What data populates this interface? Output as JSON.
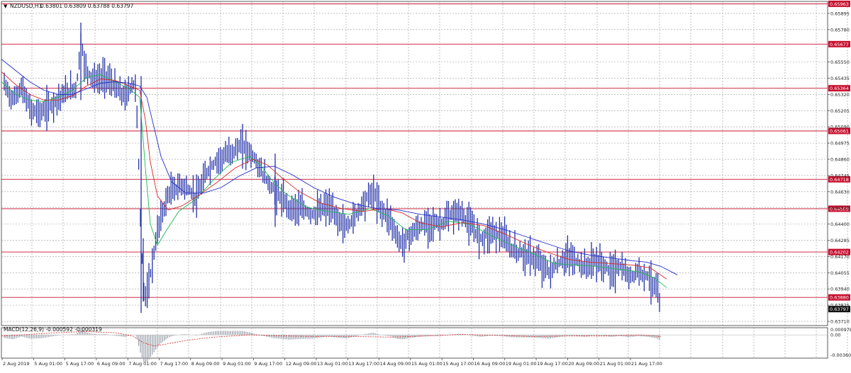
{
  "header": {
    "arrow": "▼",
    "symbol": "NZDUSD,H1",
    "ohlc": "0.63801 0.63809 0.63788 0.63797"
  },
  "macd_header": "MACD(12,26,9) -0.000592 -0.000319",
  "colors": {
    "background": "#ffffff",
    "candles": "#2433a8",
    "level_line": "#c8102e",
    "level_tag": "#c8102e",
    "ma_fast": "#1db954",
    "ma_mid": "#d62828",
    "ma_slow": "#1f2bcc",
    "macd_hist": "#9aa0aa",
    "macd_signal": "#d62828",
    "grid": "#9a9a9a"
  },
  "chart_data": {
    "type": "line",
    "title": "NZDUSD,H1",
    "price_axis_ticks": [
      "0.65895",
      "0.65780",
      "0.65550",
      "0.65435",
      "0.65320",
      "0.65205",
      "0.65090",
      "0.64975",
      "0.64860",
      "0.64745",
      "0.64630",
      "0.64515",
      "0.64400",
      "0.64285",
      "0.64170",
      "0.64055",
      "0.63940",
      "0.63825",
      "0.63710"
    ],
    "price_ylim": [
      0.6368,
      0.6598
    ],
    "horizontal_levels": [
      "0.65963",
      "0.65677",
      "0.65364",
      "0.65061",
      "0.64718",
      "0.64509",
      "0.64202",
      "0.63880"
    ],
    "current_price": "0.63797",
    "macd_axis_ticks": [
      "0.000978",
      "0.00",
      "-0.003601"
    ],
    "macd_ylim": [
      -0.0042,
      0.0013
    ],
    "x_labels": [
      "2 Aug 2019",
      "5 Aug 01:00",
      "5 Aug 17:00",
      "6 Aug 09:00",
      "7 Aug 01:00",
      "7 Aug 17:00",
      "8 Aug 09:00",
      "9 Aug 01:00",
      "9 Aug 17:00",
      "12 Aug 09:00",
      "13 Aug 01:00",
      "13 Aug 17:00",
      "14 Aug 09:00",
      "15 Aug 01:00",
      "15 Aug 17:00",
      "16 Aug 09:00",
      "19 Aug 01:00",
      "19 Aug 17:00",
      "20 Aug 09:00",
      "21 Aug 01:00",
      "21 Aug 17:00"
    ],
    "series": [
      {
        "kind": "price",
        "x": [
          0,
          16,
          28,
          41,
          57,
          73,
          90,
          106,
          112,
          118,
          126,
          135,
          147,
          160,
          174,
          185,
          190,
          196,
          200,
          205,
          212,
          222,
          236,
          255,
          275,
          290,
          305,
          318,
          330,
          340,
          348,
          356,
          366,
          378,
          390,
          405,
          420,
          440,
          460,
          475,
          487,
          500,
          512,
          524,
          536,
          548,
          558,
          565,
          575,
          590,
          606,
          620,
          634,
          645,
          660,
          676,
          690,
          705,
          720,
          730,
          745,
          760,
          772,
          788,
          800,
          812,
          824,
          836,
          848,
          860,
          872,
          885,
          898,
          912,
          924,
          930
        ],
        "y": [
          0.6543,
          0.6528,
          0.6537,
          0.6521,
          0.6519,
          0.6526,
          0.6533,
          0.6537,
          0.6571,
          0.6551,
          0.6545,
          0.6542,
          0.6545,
          0.6537,
          0.653,
          0.654,
          0.6536,
          0.6445,
          0.6395,
          0.6388,
          0.641,
          0.644,
          0.6462,
          0.6468,
          0.6459,
          0.6477,
          0.6486,
          0.6489,
          0.6493,
          0.6496,
          0.6492,
          0.6487,
          0.6478,
          0.6468,
          0.6461,
          0.6452,
          0.6451,
          0.6447,
          0.6453,
          0.6443,
          0.6438,
          0.6447,
          0.6457,
          0.6463,
          0.645,
          0.6444,
          0.643,
          0.6426,
          0.6432,
          0.6438,
          0.6441,
          0.644,
          0.6446,
          0.6449,
          0.644,
          0.643,
          0.6435,
          0.6432,
          0.6422,
          0.642,
          0.6417,
          0.6412,
          0.6406,
          0.6413,
          0.6417,
          0.6413,
          0.6409,
          0.6414,
          0.6411,
          0.6406,
          0.641,
          0.6402,
          0.6407,
          0.6403,
          0.6393,
          0.638
        ]
      },
      {
        "kind": "ma_fast",
        "x": [
          0,
          20,
          40,
          60,
          80,
          100,
          120,
          140,
          160,
          180,
          195,
          203,
          210,
          220,
          232,
          250,
          275,
          300,
          325,
          350,
          365,
          380,
          400,
          430,
          460,
          490,
          520,
          545,
          570,
          600,
          630,
          660,
          690,
          720,
          750,
          780,
          810,
          840,
          870,
          900,
          920,
          938
        ],
        "y": [
          0.6541,
          0.6532,
          0.6528,
          0.6527,
          0.653,
          0.6535,
          0.6544,
          0.6546,
          0.6541,
          0.6536,
          0.653,
          0.648,
          0.644,
          0.6425,
          0.6435,
          0.6449,
          0.6458,
          0.6472,
          0.6484,
          0.6488,
          0.6482,
          0.6472,
          0.6462,
          0.6452,
          0.6449,
          0.6447,
          0.6451,
          0.6446,
          0.6436,
          0.6436,
          0.6442,
          0.644,
          0.6432,
          0.6425,
          0.6419,
          0.6412,
          0.6411,
          0.641,
          0.6408,
          0.6406,
          0.6402,
          0.6395
        ]
      },
      {
        "kind": "ma_mid",
        "x": [
          0,
          20,
          40,
          60,
          80,
          100,
          120,
          140,
          160,
          180,
          195,
          203,
          210,
          220,
          235,
          255,
          280,
          305,
          330,
          355,
          375,
          395,
          420,
          450,
          480,
          510,
          540,
          565,
          590,
          620,
          650,
          680,
          710,
          740,
          770,
          800,
          830,
          860,
          890,
          915,
          938
        ],
        "y": [
          0.6548,
          0.6539,
          0.6532,
          0.6528,
          0.6528,
          0.6531,
          0.6538,
          0.6543,
          0.6542,
          0.6538,
          0.6535,
          0.6514,
          0.6484,
          0.646,
          0.645,
          0.6453,
          0.6461,
          0.647,
          0.648,
          0.6486,
          0.6482,
          0.6473,
          0.6463,
          0.6455,
          0.6451,
          0.6449,
          0.6451,
          0.6448,
          0.6441,
          0.6438,
          0.6441,
          0.6439,
          0.6433,
          0.6426,
          0.642,
          0.6415,
          0.6413,
          0.6412,
          0.6411,
          0.6409,
          0.6401
        ]
      },
      {
        "kind": "ma_slow",
        "x": [
          0,
          20,
          40,
          60,
          80,
          100,
          120,
          140,
          160,
          180,
          195,
          205,
          215,
          225,
          240,
          260,
          285,
          310,
          335,
          360,
          385,
          410,
          440,
          470,
          500,
          530,
          560,
          590,
          620,
          650,
          680,
          710,
          740,
          770,
          800,
          830,
          860,
          890,
          910,
          930,
          953
        ],
        "y": [
          0.6557,
          0.6549,
          0.6541,
          0.6535,
          0.6532,
          0.6532,
          0.6536,
          0.654,
          0.6541,
          0.654,
          0.6538,
          0.653,
          0.6509,
          0.6488,
          0.647,
          0.6462,
          0.6462,
          0.6466,
          0.6474,
          0.648,
          0.6481,
          0.6475,
          0.6466,
          0.6459,
          0.6454,
          0.6451,
          0.645,
          0.6447,
          0.6445,
          0.6443,
          0.644,
          0.6436,
          0.6431,
          0.6426,
          0.6421,
          0.6418,
          0.6416,
          0.6414,
          0.6413,
          0.641,
          0.6404
        ]
      },
      {
        "kind": "macd_signal",
        "x": [
          0,
          40,
          80,
          120,
          160,
          185,
          200,
          215,
          230,
          260,
          300,
          350,
          400,
          450,
          500,
          550,
          600,
          650,
          700,
          750,
          800,
          850,
          900,
          930
        ],
        "y": [
          -0.0002,
          0.0001,
          0.0004,
          0.0006,
          0.0004,
          -0.0002,
          -0.0014,
          -0.002,
          -0.0017,
          -0.001,
          -0.0004,
          0.0,
          -0.0002,
          -0.0003,
          -0.0003,
          -0.0004,
          -0.0002,
          0.0001,
          -0.0001,
          -0.0003,
          -0.0002,
          -0.0002,
          0.0,
          -0.0003
        ]
      }
    ]
  }
}
